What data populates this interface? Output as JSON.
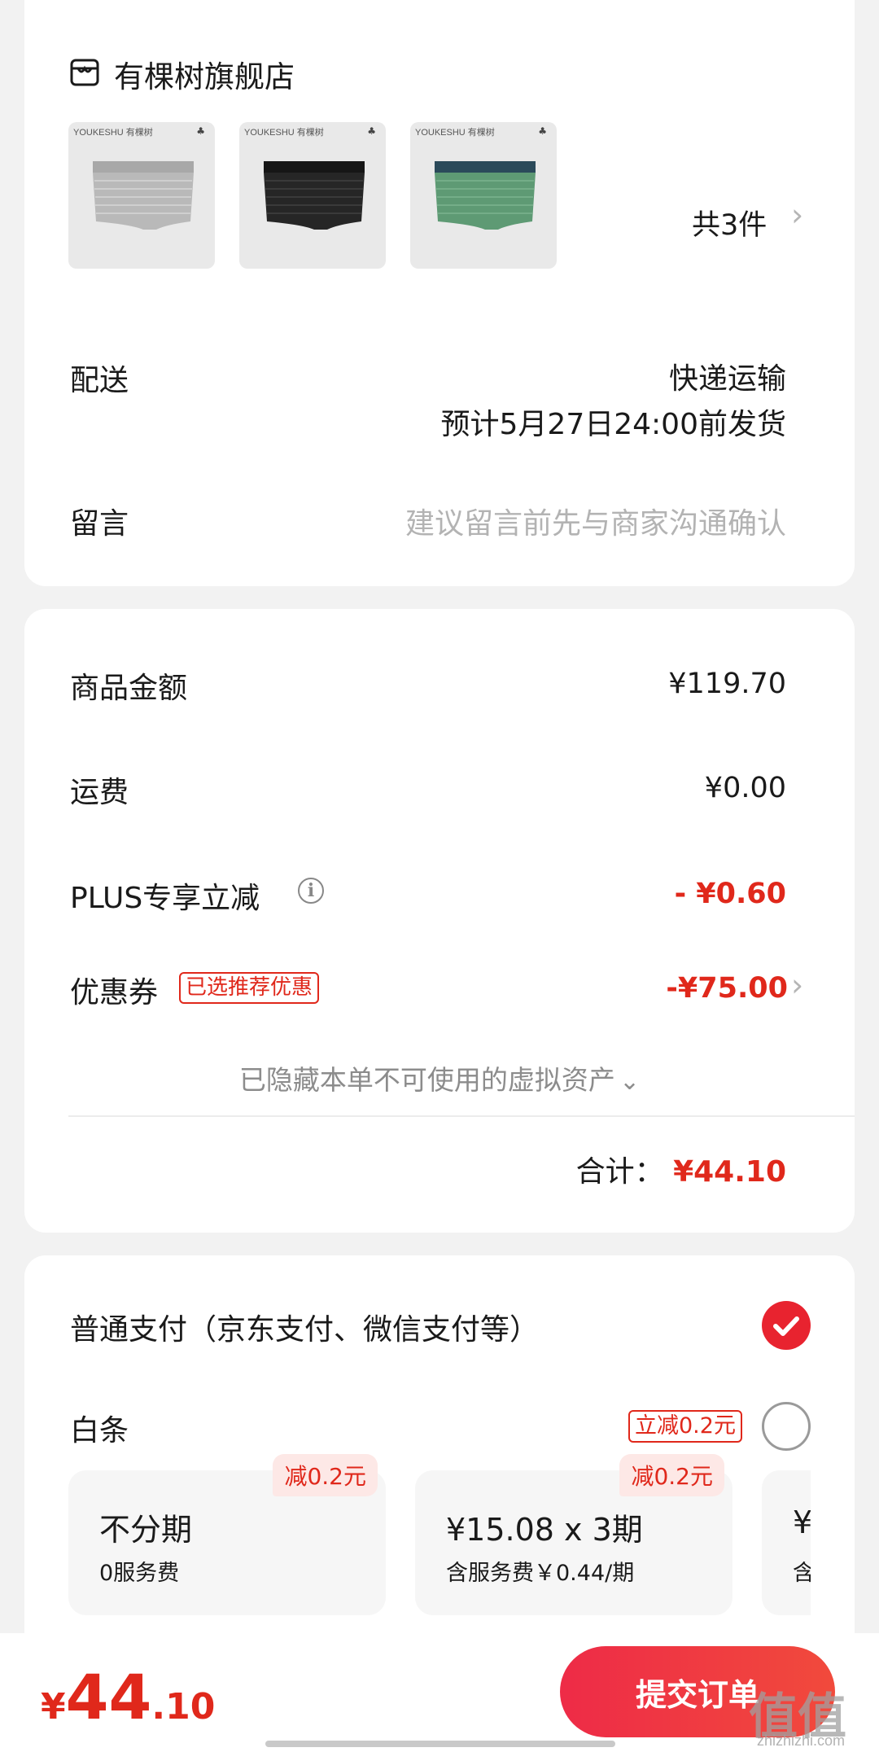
{
  "store": {
    "name": "有棵树旗舰店",
    "icon": "store-icon"
  },
  "items": {
    "thumbs": [
      {
        "brand": "YOUKESHU 有棵树",
        "color": "#b9b9b9"
      },
      {
        "brand": "YOUKESHU 有棵树",
        "color": "#262626"
      },
      {
        "brand": "YOUKESHU 有棵树",
        "color": "#5e9a74"
      }
    ],
    "count_label": "共3件"
  },
  "delivery": {
    "label": "配送",
    "method": "快递运输",
    "eta": "预计5月27日24:00前发货"
  },
  "message": {
    "label": "留言",
    "placeholder": "建议留言前先与商家沟通确认"
  },
  "summary": {
    "goods_label": "商品金额",
    "goods_value": "¥119.70",
    "shipping_label": "运费",
    "shipping_value": "¥0.00",
    "plus_label": "PLUS专享立减",
    "plus_value": "- ¥0.60",
    "coupon_label": "优惠券",
    "coupon_tag": "已选推荐优惠",
    "coupon_value": "-¥75.00",
    "hidden_assets": "已隐藏本单不可使用的虚拟资产",
    "total_label": "合计：",
    "total_value": "¥44.10"
  },
  "payment": {
    "normal_label": "普通支付（京东支付、微信支付等）",
    "baitiao_label": "白条",
    "baitiao_tag": "立减0.2元",
    "plans": [
      {
        "badge": "减0.2元",
        "title": "不分期",
        "sub": "0服务费"
      },
      {
        "badge": "减0.2元",
        "title": "¥15.08 x 3期",
        "sub": "含服务费￥0.44/期"
      },
      {
        "title": "¥",
        "sub": "含"
      }
    ]
  },
  "footer": {
    "price_symbol": "¥",
    "price_int": "44",
    "price_dec": ".10",
    "submit_label": "提交订单",
    "watermark": "值值值",
    "watermark_sub": "zhizhizhi.com"
  },
  "colors": {
    "accent": "#e0281b",
    "submit_start": "#ee2b47",
    "submit_end": "#f14a3c"
  }
}
